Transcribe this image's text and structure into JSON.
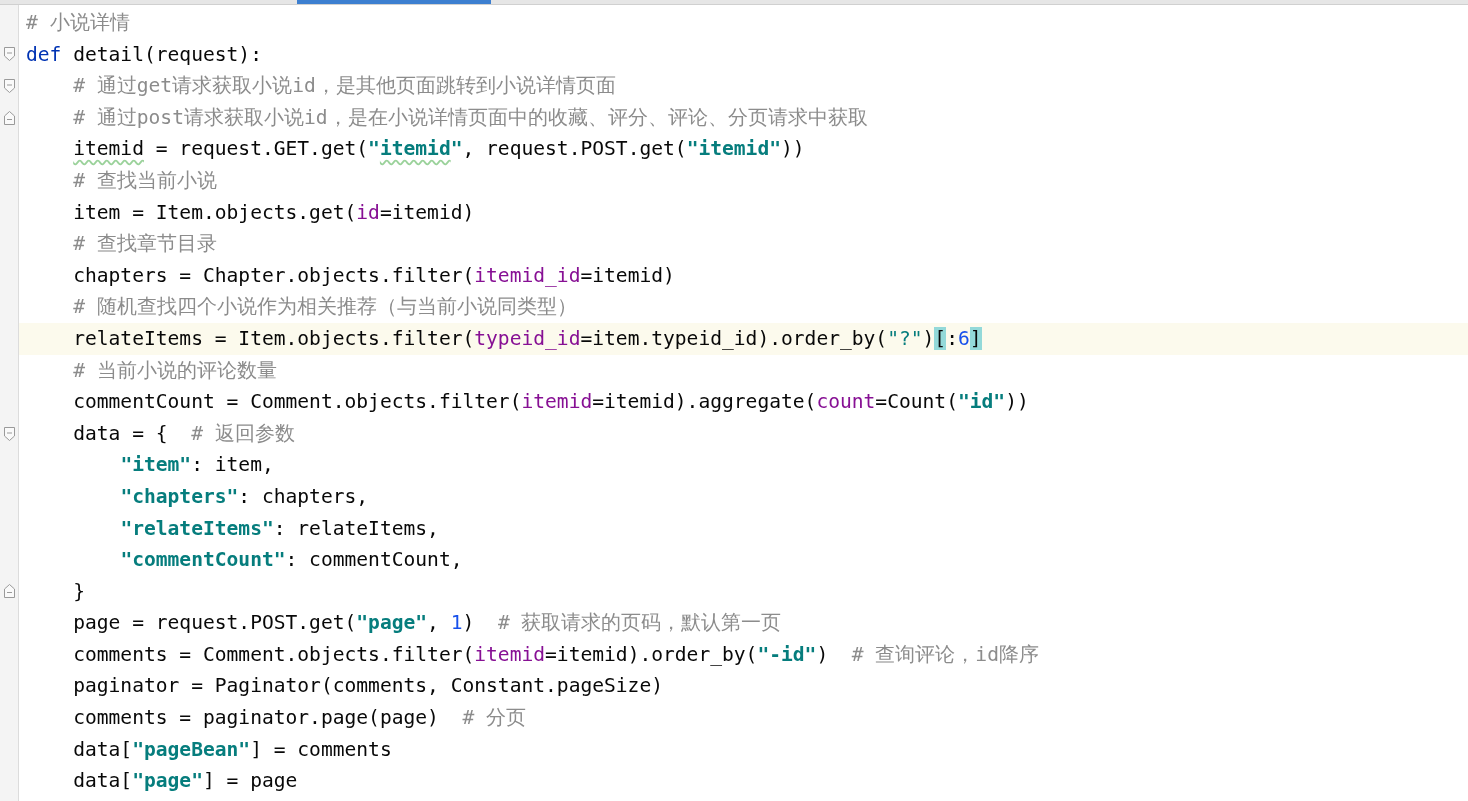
{
  "scrollbar": {
    "kind": "horizontal"
  },
  "lines": [
    {
      "fold_start": false,
      "fold_end": false,
      "current": false,
      "tokens": [
        {
          "kind": "comment",
          "text": "# 小说详情"
        }
      ]
    },
    {
      "fold_start": true,
      "fold_end": false,
      "current": false,
      "tokens": [
        {
          "kind": "kw",
          "text": "def"
        },
        {
          "kind": "plain",
          "text": " detail(request):"
        }
      ]
    },
    {
      "fold_start": true,
      "fold_end": false,
      "current": false,
      "tokens": [
        {
          "kind": "comment",
          "text": "    # 通过get请求获取小说id，是其他页面跳转到小说详情页面"
        }
      ]
    },
    {
      "fold_start": false,
      "fold_end": true,
      "current": false,
      "tokens": [
        {
          "kind": "comment",
          "text": "    # 通过post请求获取小说id，是在小说详情页面中的收藏、评分、评论、分页请求中获取"
        }
      ]
    },
    {
      "fold_start": false,
      "fold_end": false,
      "current": false,
      "tokens": [
        {
          "kind": "plain",
          "text": "    itemid",
          "typo": true
        },
        {
          "kind": "plain",
          "text": " = request.GET.get("
        },
        {
          "kind": "str",
          "text": "\""
        },
        {
          "kind": "str",
          "text": "itemid",
          "typo": true
        },
        {
          "kind": "str",
          "text": "\""
        },
        {
          "kind": "plain",
          "text": ", request.POST.get("
        },
        {
          "kind": "str",
          "text": "\"itemid\""
        },
        {
          "kind": "plain",
          "text": "))"
        }
      ]
    },
    {
      "fold_start": false,
      "fold_end": false,
      "current": false,
      "tokens": [
        {
          "kind": "comment",
          "text": "    # 查找当前小说"
        }
      ]
    },
    {
      "fold_start": false,
      "fold_end": false,
      "current": false,
      "tokens": [
        {
          "kind": "plain",
          "text": "    item = Item.objects.get("
        },
        {
          "kind": "param",
          "text": "id"
        },
        {
          "kind": "plain",
          "text": "=itemid)"
        }
      ]
    },
    {
      "fold_start": false,
      "fold_end": false,
      "current": false,
      "tokens": [
        {
          "kind": "comment",
          "text": "    # 查找章节目录"
        }
      ]
    },
    {
      "fold_start": false,
      "fold_end": false,
      "current": false,
      "tokens": [
        {
          "kind": "plain",
          "text": "    chapters = Chapter.objects.filter("
        },
        {
          "kind": "param",
          "text": "itemid_id"
        },
        {
          "kind": "plain",
          "text": "=itemid)"
        }
      ]
    },
    {
      "fold_start": false,
      "fold_end": false,
      "current": false,
      "tokens": [
        {
          "kind": "comment",
          "text": "    # 随机查找四个小说作为相关推荐（与当前小说同类型）"
        }
      ]
    },
    {
      "fold_start": false,
      "fold_end": false,
      "current": true,
      "tokens": [
        {
          "kind": "plain",
          "text": "    relateItems = Item.objects.filter("
        },
        {
          "kind": "param",
          "text": "typeid_id"
        },
        {
          "kind": "plain",
          "text": "=item.typeid_id).order_by("
        },
        {
          "kind": "str",
          "text": "\"?\"",
          "bold": false
        },
        {
          "kind": "plain",
          "text": ")"
        },
        {
          "kind": "plain",
          "text": "[",
          "matched": true
        },
        {
          "kind": "plain",
          "text": ":"
        },
        {
          "kind": "num",
          "text": "6"
        },
        {
          "kind": "caret"
        },
        {
          "kind": "plain",
          "text": "]",
          "matched": true
        }
      ]
    },
    {
      "fold_start": false,
      "fold_end": false,
      "current": false,
      "tokens": [
        {
          "kind": "comment",
          "text": "    # 当前小说的评论数量"
        }
      ]
    },
    {
      "fold_start": false,
      "fold_end": false,
      "current": false,
      "tokens": [
        {
          "kind": "plain",
          "text": "    commentCount = Comment.objects.filter("
        },
        {
          "kind": "param",
          "text": "itemid"
        },
        {
          "kind": "plain",
          "text": "=itemid).aggregate("
        },
        {
          "kind": "param",
          "text": "count"
        },
        {
          "kind": "plain",
          "text": "=Count("
        },
        {
          "kind": "str",
          "text": "\"id\""
        },
        {
          "kind": "plain",
          "text": "))"
        }
      ]
    },
    {
      "fold_start": true,
      "fold_end": false,
      "current": false,
      "tokens": [
        {
          "kind": "plain",
          "text": "    data = {  "
        },
        {
          "kind": "comment",
          "text": "# 返回参数"
        }
      ]
    },
    {
      "fold_start": false,
      "fold_end": false,
      "current": false,
      "tokens": [
        {
          "kind": "str",
          "text": "        \"item\""
        },
        {
          "kind": "plain",
          "text": ": item,"
        }
      ]
    },
    {
      "fold_start": false,
      "fold_end": false,
      "current": false,
      "tokens": [
        {
          "kind": "str",
          "text": "        \"chapters\""
        },
        {
          "kind": "plain",
          "text": ": chapters,"
        }
      ]
    },
    {
      "fold_start": false,
      "fold_end": false,
      "current": false,
      "tokens": [
        {
          "kind": "str",
          "text": "        \"relateItems\""
        },
        {
          "kind": "plain",
          "text": ": relateItems,"
        }
      ]
    },
    {
      "fold_start": false,
      "fold_end": false,
      "current": false,
      "tokens": [
        {
          "kind": "str",
          "text": "        \"commentCount\""
        },
        {
          "kind": "plain",
          "text": ": commentCount,"
        }
      ]
    },
    {
      "fold_start": false,
      "fold_end": true,
      "current": false,
      "tokens": [
        {
          "kind": "plain",
          "text": "    }"
        }
      ]
    },
    {
      "fold_start": false,
      "fold_end": false,
      "current": false,
      "tokens": [
        {
          "kind": "plain",
          "text": "    page = request.POST.get("
        },
        {
          "kind": "str",
          "text": "\"page\""
        },
        {
          "kind": "plain",
          "text": ", "
        },
        {
          "kind": "num",
          "text": "1"
        },
        {
          "kind": "plain",
          "text": ")  "
        },
        {
          "kind": "comment",
          "text": "# 获取请求的页码，默认第一页"
        }
      ]
    },
    {
      "fold_start": false,
      "fold_end": false,
      "current": false,
      "tokens": [
        {
          "kind": "plain",
          "text": "    comments = Comment.objects.filter("
        },
        {
          "kind": "param",
          "text": "itemid"
        },
        {
          "kind": "plain",
          "text": "=itemid).order_by("
        },
        {
          "kind": "str",
          "text": "\"-id\""
        },
        {
          "kind": "plain",
          "text": ")  "
        },
        {
          "kind": "comment",
          "text": "# 查询评论，id降序"
        }
      ]
    },
    {
      "fold_start": false,
      "fold_end": false,
      "current": false,
      "tokens": [
        {
          "kind": "plain",
          "text": "    paginator = Paginator(comments, Constant.pageSize)"
        }
      ]
    },
    {
      "fold_start": false,
      "fold_end": false,
      "current": false,
      "tokens": [
        {
          "kind": "plain",
          "text": "    comments = paginator.page(page)  "
        },
        {
          "kind": "comment",
          "text": "# 分页"
        }
      ]
    },
    {
      "fold_start": false,
      "fold_end": false,
      "current": false,
      "tokens": [
        {
          "kind": "plain",
          "text": "    data["
        },
        {
          "kind": "str",
          "text": "\"pageBean\""
        },
        {
          "kind": "plain",
          "text": "] = comments"
        }
      ]
    },
    {
      "fold_start": false,
      "fold_end": false,
      "current": false,
      "tokens": [
        {
          "kind": "plain",
          "text": "    data["
        },
        {
          "kind": "str",
          "text": "\"page\""
        },
        {
          "kind": "plain",
          "text": "] = page"
        }
      ]
    }
  ]
}
